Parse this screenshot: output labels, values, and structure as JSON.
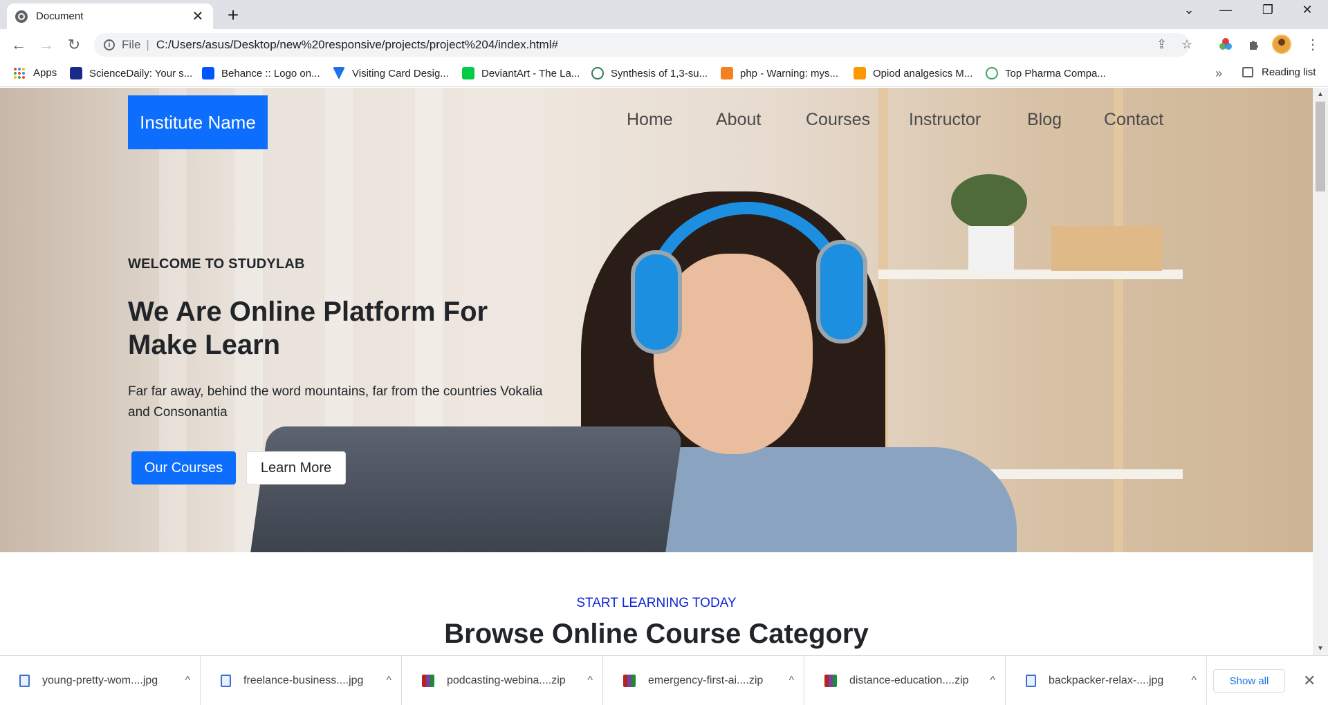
{
  "browser": {
    "tab_title": "Document",
    "tab_close": "✕",
    "new_tab": "+",
    "window_controls": {
      "tabsearch": "⌄",
      "minimize": "—",
      "restore": "❐",
      "close": "✕"
    },
    "nav": {
      "back": "←",
      "forward": "→",
      "reload": "↻"
    },
    "address": {
      "scheme": "File",
      "separator": "|",
      "url": "C:/Users/asus/Desktop/new%20responsive/projects/project%204/index.html#"
    },
    "kebab": "⋮",
    "bookmarks": [
      {
        "label": "Apps",
        "icon": "apps-grid-icon"
      },
      {
        "label": "ScienceDaily: Your s...",
        "icon": "sciencedaily-icon",
        "color": "#1a2a8a"
      },
      {
        "label": "Behance :: Logo on...",
        "icon": "behance-icon",
        "color": "#0057ff"
      },
      {
        "label": "Visiting Card Desig...",
        "icon": "vector-icon",
        "color": "#1a73e8"
      },
      {
        "label": "DeviantArt - The La...",
        "icon": "deviantart-icon",
        "color": "#05cc47"
      },
      {
        "label": "Synthesis of 1,3-su...",
        "icon": "journal-icon",
        "color": "#2e7d4f"
      },
      {
        "label": "php - Warning: mys...",
        "icon": "stackoverflow-icon",
        "color": "#f48024"
      },
      {
        "label": "Opiod analgesics M...",
        "icon": "shield-icon",
        "color": "#ff9800"
      },
      {
        "label": "Top Pharma Compa...",
        "icon": "clover-icon",
        "color": "#3aa757"
      }
    ],
    "bookmarks_overflow": "»",
    "reading_list": "Reading list"
  },
  "page": {
    "brand": "Institute Name",
    "nav": [
      "Home",
      "About",
      "Courses",
      "Instructor",
      "Blog",
      "Contact"
    ],
    "hero": {
      "eyebrow": "WELCOME TO STUDYLAB",
      "heading": "We Are Online Platform For Make Learn",
      "lede": "Far far away, behind the word mountains, far from the countries Vokalia and Consonantia",
      "primary_button": "Our Courses",
      "secondary_button": "Learn More"
    },
    "section": {
      "eyebrow": "START LEARNING TODAY",
      "heading": "Browse Online Course Category"
    },
    "colors": {
      "primary": "#0d6efd",
      "eyebrow_blue": "#0d24d9"
    }
  },
  "downloads": {
    "items": [
      {
        "name": "young-pretty-wom....jpg",
        "type": "image"
      },
      {
        "name": "freelance-business....jpg",
        "type": "image"
      },
      {
        "name": "podcasting-webina....zip",
        "type": "zip"
      },
      {
        "name": "emergency-first-ai....zip",
        "type": "zip"
      },
      {
        "name": "distance-education....zip",
        "type": "zip"
      },
      {
        "name": "backpacker-relax-....jpg",
        "type": "image"
      }
    ],
    "caret": "^",
    "show_all": "Show all",
    "close": "✕"
  }
}
